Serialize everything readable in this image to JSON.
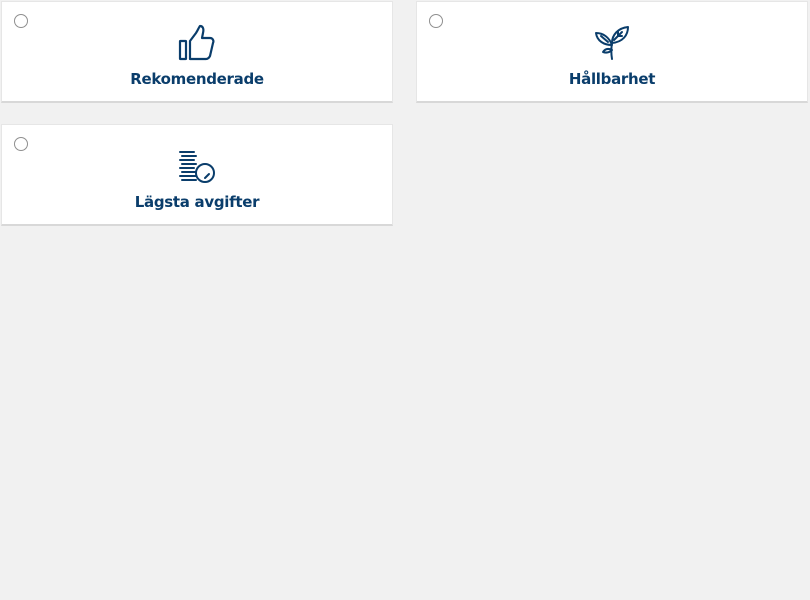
{
  "colors": {
    "accent": "#0a3d6b",
    "card_bg": "#ffffff",
    "page_bg": "#f1f1f1",
    "radio_border": "#8f8f8f"
  },
  "options": [
    {
      "label": "Rekomenderade",
      "icon": "thumbs-up-icon",
      "selected": false
    },
    {
      "label": "Hållbarhet",
      "icon": "leaf-icon",
      "selected": false
    },
    {
      "label": "Lägsta avgifter",
      "icon": "coins-icon",
      "selected": false
    }
  ]
}
